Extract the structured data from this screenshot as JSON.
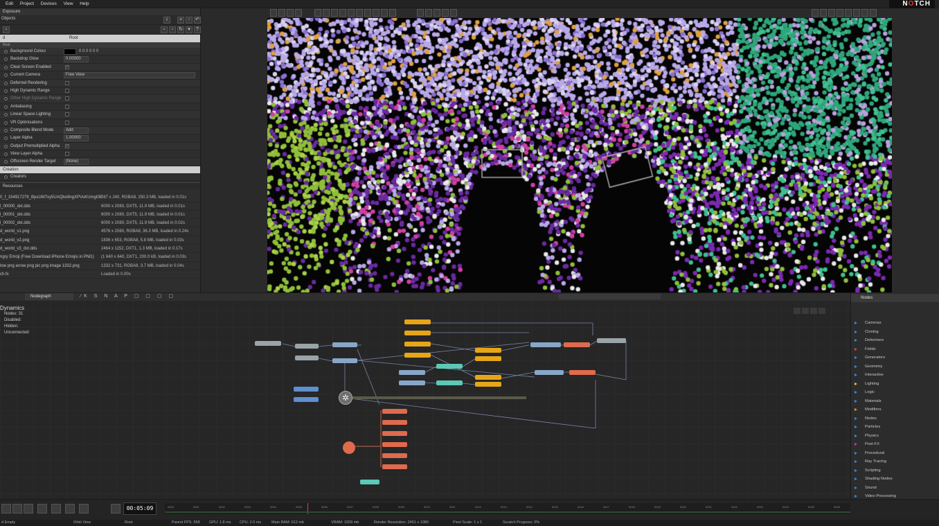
{
  "app": {
    "logo": "N",
    "logo_o": "O",
    "logo_rest": "TCH"
  },
  "menu": [
    "Edit",
    "Project",
    "Devices",
    "View",
    "Help"
  ],
  "left_panel": {
    "title": "Exposure",
    "sub": "Objects",
    "columns": {
      "left": "d",
      "right": "Root"
    },
    "section": "Root",
    "properties": [
      {
        "label": "Background Colour",
        "kind": "color",
        "value": "0 0 0 0 0 0"
      },
      {
        "label": "Backdrop Glow",
        "kind": "field",
        "value": "0.00000"
      },
      {
        "label": "Clear Screen Enabled",
        "kind": "check",
        "checked": true
      },
      {
        "label": "Current Camera",
        "kind": "field",
        "value": "Free View"
      },
      {
        "label": "Deferred Rendering",
        "kind": "check",
        "checked": false
      },
      {
        "label": "High Dynamic Range",
        "kind": "check",
        "checked": false
      },
      {
        "label": "Other High Dynamic Range",
        "kind": "check",
        "checked": false,
        "dim": true
      },
      {
        "label": "Antialiasing",
        "kind": "check",
        "checked": false
      },
      {
        "label": "Linear Space Lighting",
        "kind": "check",
        "checked": false
      },
      {
        "label": "VR Optimisations",
        "kind": "check",
        "checked": false
      },
      {
        "label": "Composite Blend Mode",
        "kind": "field",
        "value": "Add"
      },
      {
        "label": "Layer Alpha",
        "kind": "field",
        "value": "1.00000"
      },
      {
        "label": "Output Premultiplied Alpha",
        "kind": "check",
        "checked": true
      },
      {
        "label": "View Layer Alpha",
        "kind": "check",
        "checked": false
      },
      {
        "label": "Offscreen Render Target",
        "kind": "field",
        "value": "(None)"
      }
    ],
    "section2": "Creation",
    "creators_label": "Creators",
    "resources_title": "Resources",
    "resources": [
      {
        "name": "0_f_154917279_BpsUM7xy5UAQbo9ngXPVuKUmgI0E",
        "info": "267 x 240, RGBA8, 250.3 MB, loaded in 0.01s"
      },
      {
        "name": "l_00000_dxt.dds",
        "info": "6000 x 2080, DXT5, 11.9 MB, loaded in 0.01s"
      },
      {
        "name": "l_00001_dxt.dds",
        "info": "6000 x 2080, DXT5, 11.9 MB, loaded in 0.01s"
      },
      {
        "name": "l_00002_dxt.dds",
        "info": "6000 x 2080, DXT5, 11.9 MB, loaded in 0.02s"
      },
      {
        "name": "d_world_v1.png",
        "info": "4576 x 2080, RGBA8, 36.3 MB, loaded in 0.24s"
      },
      {
        "name": "d_world_v2.png",
        "info": "1836 x 653, RGBA8, 5.8 MB, loaded in 0.03s"
      },
      {
        "name": "d_world_v3_dxt.dds",
        "info": "2464 x 1152, DXT1, 1.3 MB, loaded in 0.17s"
      },
      {
        "name": "ngry Emoji (Free Download iPhone Emojis in PNG)",
        "info": "(1 640 x 640, DXT1, 200.0 kB, loaded in 0.03s"
      },
      {
        "name": "low png arrow png pic png image 1332.png",
        "info": "1332 x 731, RGBA8, 3.7 MB, loaded in 0.04s"
      },
      {
        "name": "ch.fx",
        "info": "Loaded in 0.00s"
      }
    ]
  },
  "nodegraph": {
    "tab": "Nodegraph",
    "title": "Dynamics",
    "stats": [
      "Nodes: 31",
      "Disabled:",
      "Hidden:",
      "Unconnected:"
    ]
  },
  "nodes_panel": {
    "title": "Nodes",
    "categories": [
      "Cameras",
      "Cloning",
      "Deformers",
      "Fields",
      "Generators",
      "Geometry",
      "Interactive",
      "Lighting",
      "Logic",
      "Materials",
      "Modifiers",
      "Nodes",
      "Particles",
      "Physics",
      "Post-FX",
      "Procedural",
      "Ray Tracing",
      "Scripting",
      "Shading Nodes",
      "Sound",
      "Video Processing"
    ],
    "colors": [
      "#3a8ee0",
      "#3a8ee0",
      "#3a8ee0",
      "#e04848",
      "#3a8ee0",
      "#3a8ee0",
      "#3a8ee0",
      "#e0d040",
      "#3a8ee0",
      "#3a8ee0",
      "#e0a030",
      "#3a8ee0",
      "#3a8ee0",
      "#3a8ee0",
      "#c040c0",
      "#3a8ee0",
      "#3a8ee0",
      "#3a8ee0",
      "#3a8ee0",
      "#3a8ee0",
      "#3a8ee0"
    ]
  },
  "timeline": {
    "timecode": "00:05:09",
    "ticks": [
      "0000",
      "0001",
      "0002",
      "0003",
      "0004",
      "0005",
      "0006",
      "0007",
      "0008",
      "0009",
      "0010",
      "0011",
      "0012",
      "0013",
      "0014",
      "0015",
      "0016",
      "0017",
      "0018",
      "0019",
      "0020",
      "0021",
      "0022",
      "0023",
      "0024",
      "0025",
      "0026"
    ]
  },
  "status": {
    "layer": "d Empty",
    "view": "Orbit View",
    "root": "Root",
    "fps": "Parent FPS: 558",
    "gpu": "GPU: 1.8 ms",
    "cpu": "CPU: 2.0 ms",
    "ram": "Main RAM: 612 mb",
    "vram": "VRAM: 1009 mb",
    "res": "Render Resolution: 2461 x 1080",
    "pixel": "Pixel Scale: 1 x 1",
    "scratch": "Scratch Progress: 0%"
  }
}
